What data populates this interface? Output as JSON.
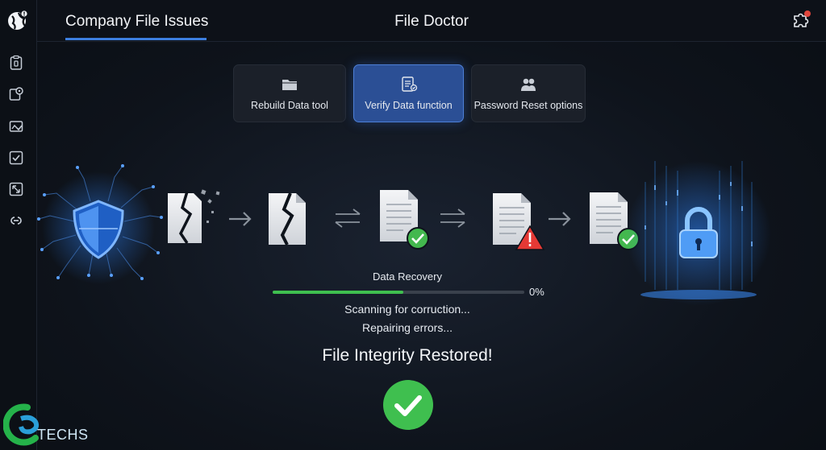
{
  "topbar": {
    "app_title": "Company File Issues",
    "center_title": "File Doctor"
  },
  "sidebar": {
    "icons": [
      "clipboard-icon",
      "map-pin-icon",
      "image-check-icon",
      "checkbox-icon",
      "resize-icon",
      "link-icon"
    ]
  },
  "cards": [
    {
      "label": "Rebuild Data tool",
      "icon": "folder-icon",
      "active": false
    },
    {
      "label": "Verify Data function",
      "icon": "document-list-icon",
      "active": true
    },
    {
      "label": "Password Reset options",
      "icon": "users-icon",
      "active": false
    }
  ],
  "progress": {
    "title": "Data Recovery",
    "percent_label": "0%",
    "fill_fraction": 0.52
  },
  "status": {
    "line1": "Scanning for corruction...",
    "line2": "Repairing errors...",
    "restored": "File Integrity Restored!"
  },
  "brand": {
    "text": "TECHS"
  },
  "colors": {
    "accent": "#3d7fe0",
    "success": "#3fbf4f",
    "warning": "#e53935",
    "card_active": "#2b4f95"
  }
}
